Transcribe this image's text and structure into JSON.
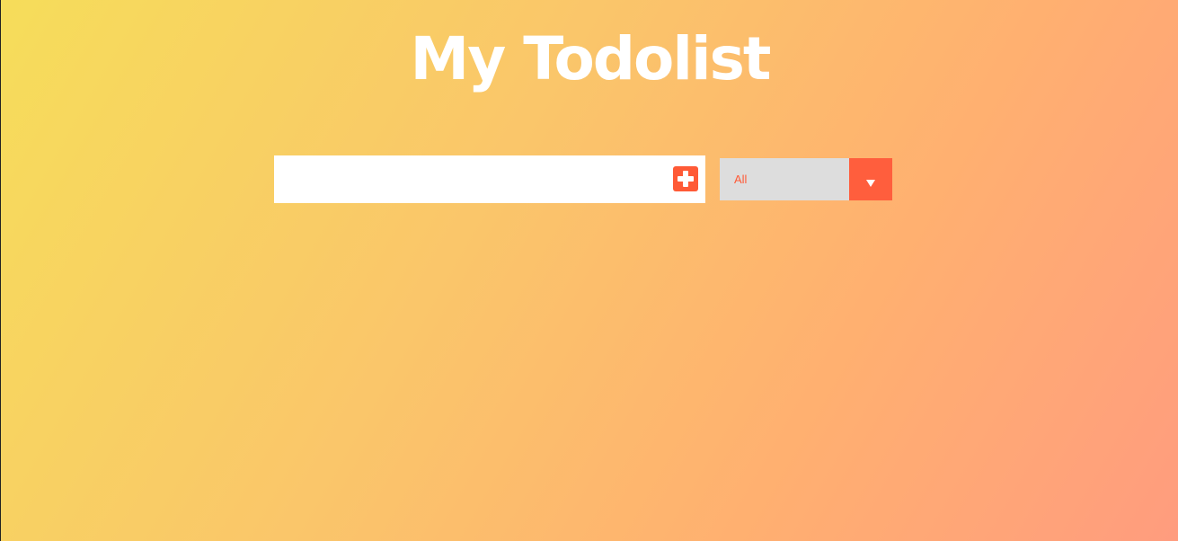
{
  "header": {
    "title": "My Todolist"
  },
  "todo_form": {
    "input_value": "",
    "input_placeholder": "",
    "add_icon": "plus-square-icon"
  },
  "filter": {
    "selected": "All",
    "arrow_icon": "chevron-down-icon"
  },
  "colors": {
    "accent": "#ff5a36",
    "gradient_start": "#f6dd5a",
    "gradient_end": "#ff9c7e",
    "select_background": "#dddddd"
  }
}
